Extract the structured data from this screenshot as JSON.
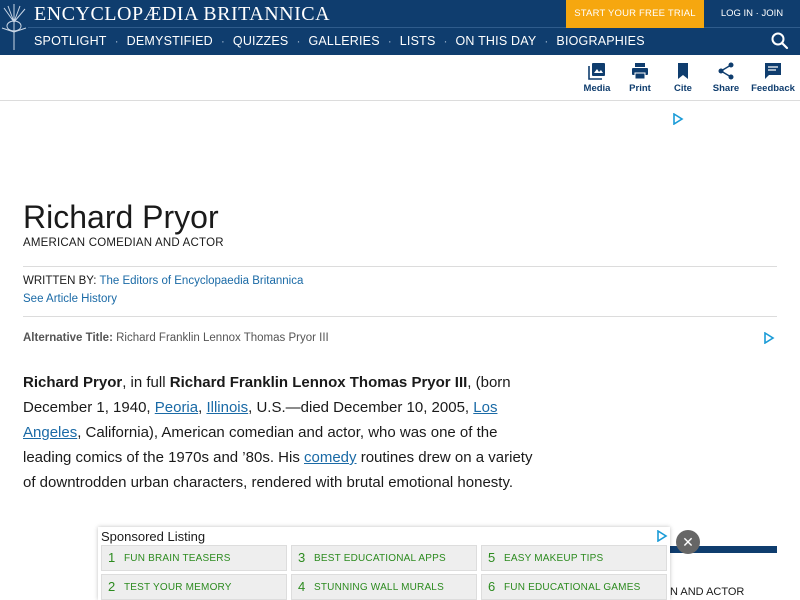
{
  "header": {
    "brand": "ENCYCLOPÆDIA BRITANNICA",
    "cta_label": "START YOUR FREE TRIAL",
    "login_label": "LOG IN · JOIN",
    "nav": [
      "SPOTLIGHT",
      "DEMYSTIFIED",
      "QUIZZES",
      "GALLERIES",
      "LISTS",
      "ON THIS DAY",
      "BIOGRAPHIES"
    ],
    "nav_separator": "·",
    "search_icon": "search-icon"
  },
  "toolbar": {
    "media": "Media",
    "print": "Print",
    "cite": "Cite",
    "share": "Share",
    "feedback": "Feedback"
  },
  "article": {
    "title": "Richard Pryor",
    "subtitle": "AMERICAN COMEDIAN AND ACTOR",
    "written_by_label": "WRITTEN BY: ",
    "written_by_author": "The Editors of Encyclopaedia Britannica",
    "history_link": "See Article History",
    "alt_title_label": "Alternative Title: ",
    "alt_title_value": "Richard Franklin Lennox Thomas Pryor III",
    "body": {
      "name": "Richard Pryor",
      "t1": ", in full ",
      "full_name": "Richard Franklin Lennox Thomas Pryor III",
      "t2": ", (born December 1, 1940, ",
      "link_peoria": "Peoria",
      "t3": ", ",
      "link_illinois": "Illinois",
      "t4": ", U.S.—died December 10, 2005, ",
      "link_la": "Los Angeles",
      "t5": ", California), American comedian and actor, who was one of the leading comics of the 1970s and ’80s. His ",
      "link_comedy": "comedy",
      "t6": " routines drew on a variety of downtrodden urban characters, rendered with brutal emotional honesty."
    }
  },
  "sponsored": {
    "title": "Sponsored Listing",
    "items": [
      {
        "num": "1",
        "label": "FUN BRAIN TEASERS"
      },
      {
        "num": "3",
        "label": "BEST EDUCATIONAL APPS"
      },
      {
        "num": "5",
        "label": "EASY MAKEUP TIPS"
      },
      {
        "num": "2",
        "label": "TEST YOUR MEMORY"
      },
      {
        "num": "4",
        "label": "STUNNING WALL MURALS"
      },
      {
        "num": "6",
        "label": "FUN EDUCATIONAL GAMES"
      }
    ],
    "close_label": "✕"
  },
  "sidebar": {
    "partial_text": "N AND ACTOR"
  },
  "colors": {
    "header_bg": "#0f3d6e",
    "cta_bg": "#f6a70f",
    "link": "#1a6aa6",
    "sponsored_text": "#2c8b1f"
  }
}
